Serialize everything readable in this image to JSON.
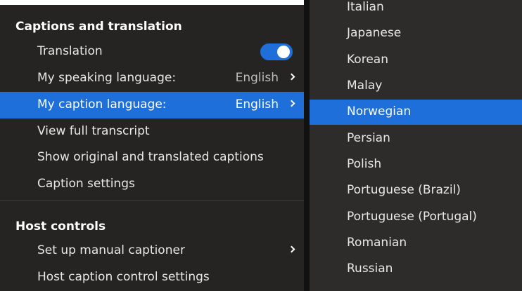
{
  "captions": {
    "header": "Captions and translation",
    "items": [
      {
        "label": "Translation"
      },
      {
        "label": "My speaking language:",
        "value": "English"
      },
      {
        "label": "My caption language:",
        "value": "English"
      },
      {
        "label": "View full transcript"
      },
      {
        "label": "Show original and translated captions"
      },
      {
        "label": "Caption settings"
      }
    ],
    "translation_enabled": true
  },
  "host": {
    "header": "Host controls",
    "items": [
      {
        "label": "Set up manual captioner"
      },
      {
        "label": "Host caption control settings"
      }
    ]
  },
  "languages": {
    "items": [
      "Italian",
      "Japanese",
      "Korean",
      "Malay",
      "Norwegian",
      "Persian",
      "Polish",
      "Portuguese (Brazil)",
      "Portuguese (Portugal)",
      "Romanian",
      "Russian"
    ],
    "selected": "Norwegian"
  },
  "colors": {
    "accent": "#1e6fd9",
    "menu_background": "#252423",
    "submenu_background": "#2d2c2b"
  },
  "icons": [
    "chevron-right-icon",
    "toggle-switch"
  ]
}
